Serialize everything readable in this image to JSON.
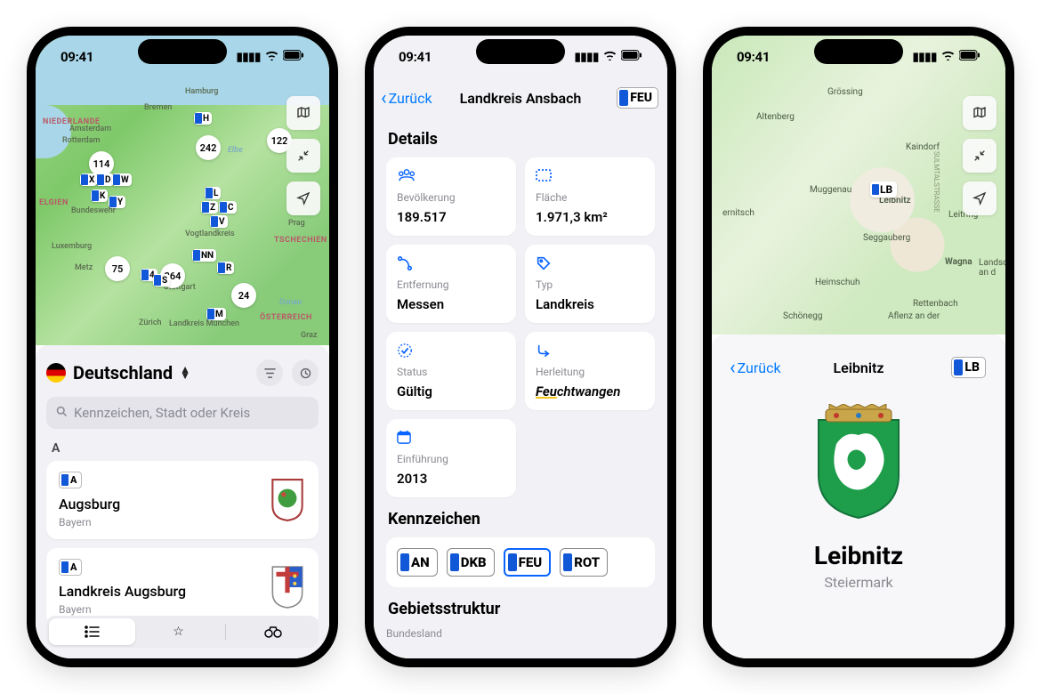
{
  "status": {
    "time": "09:41"
  },
  "phone1": {
    "country": "Deutschland",
    "search_placeholder": "Kennzeichen, Stadt oder Kreis",
    "section_letter": "A",
    "items": [
      {
        "plate": "A",
        "name": "Augsburg",
        "region": "Bayern"
      },
      {
        "plate": "A",
        "name": "Landkreis Augsburg",
        "region": "Bayern"
      }
    ],
    "map": {
      "clusters": [
        {
          "n": "114"
        },
        {
          "n": "242"
        },
        {
          "n": "122"
        },
        {
          "n": "75"
        },
        {
          "n": "264"
        },
        {
          "n": "24"
        }
      ],
      "markers": [
        "H",
        "X",
        "D",
        "W",
        "K",
        "Y",
        "4",
        "S",
        "NN",
        "L",
        "Z",
        "C",
        "V",
        "R",
        "M"
      ],
      "cities": [
        "Hamburg",
        "Bremen",
        "Amsterdam",
        "Rotterdam",
        "Bundeswehr",
        "Luxemburg",
        "Metz",
        "Stuttgart",
        "Zürich",
        "Vogtlandkreis",
        "Landkreis München",
        "Prag",
        "Graz"
      ],
      "countries": [
        "NIEDERLANDE",
        "ELGIEN",
        "TSCHECHIEN",
        "ÖSTERREICH"
      ],
      "rivers": [
        "Elbe",
        "Donau"
      ]
    }
  },
  "phone2": {
    "back": "Zurück",
    "title": "Landkreis Ansbach",
    "active_plate": "FEU",
    "sections": {
      "details": "Details",
      "plates": "Kennzeichen",
      "structure": "Gebietsstruktur",
      "sublabel": "Bundesland"
    },
    "cards": {
      "population": {
        "label": "Bevölkerung",
        "value": "189.517"
      },
      "area": {
        "label": "Fläche",
        "value": "1.971,3 km²"
      },
      "distance": {
        "label": "Entfernung",
        "value": "Messen"
      },
      "type": {
        "label": "Typ",
        "value": "Landkreis"
      },
      "status": {
        "label": "Status",
        "value": "Gültig"
      },
      "derivation": {
        "label": "Herleitung",
        "prefix": "Feu",
        "rest": "chtwangen"
      },
      "intro": {
        "label": "Einführung",
        "value": "2013"
      }
    },
    "plates": [
      "AN",
      "DKB",
      "FEU",
      "ROT"
    ]
  },
  "phone3": {
    "back": "Zurück",
    "title": "Leibnitz",
    "plate": "LB",
    "city": "Leibnitz",
    "region": "Steiermark",
    "map_towns": [
      "Grössing",
      "Altenberg",
      "Kaindorf",
      "Muggenau",
      "Leibnitz",
      "Leitring",
      "Seggauberg",
      "Wagna",
      "Heimschuh",
      "Rettenbach",
      "Schönegg",
      "Aflenz an der",
      "ernitsch",
      "Landsch an d"
    ],
    "map_marker": "LB"
  }
}
